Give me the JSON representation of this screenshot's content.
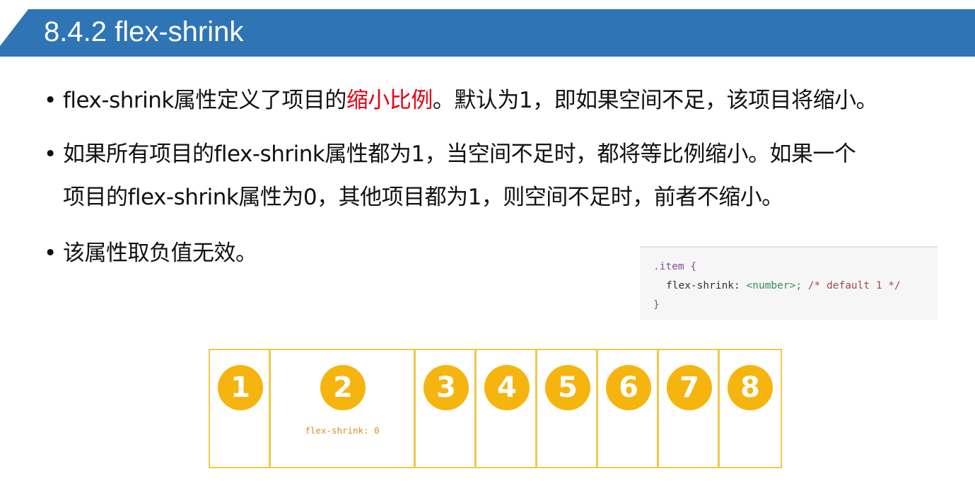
{
  "header": {
    "title": "8.4.2 flex-shrink"
  },
  "bullets": [
    {
      "lines": [
        {
          "before": "flex-shrink属性定义了项目的",
          "highlight": "缩小比例",
          "after": "。默认为1，即如果空间不足，该项目将缩小。"
        }
      ]
    },
    {
      "lines": [
        {
          "text": "如果所有项目的flex-shrink属性都为1，当空间不足时，都将等比例缩小。如果一个"
        },
        {
          "text": "项目的flex-shrink属性为0，其他项目都为1，则空间不足时，前者不缩小。"
        }
      ]
    },
    {
      "lines": [
        {
          "text": "该属性取负值无效。"
        }
      ]
    }
  ],
  "bullet_char": "•",
  "code": {
    "line1": ".item {",
    "line2_prop": "flex-shrink:",
    "line2_value": "<number>;",
    "line2_comment": "/* default 1 */",
    "line3": "}"
  },
  "flex_demo": {
    "items": [
      {
        "label": "1",
        "note": ""
      },
      {
        "label": "2",
        "note": "flex-shrink: 0"
      },
      {
        "label": "3",
        "note": ""
      },
      {
        "label": "4",
        "note": ""
      },
      {
        "label": "5",
        "note": ""
      },
      {
        "label": "6",
        "note": ""
      },
      {
        "label": "7",
        "note": ""
      },
      {
        "label": "8",
        "note": ""
      }
    ]
  },
  "colors": {
    "header_bg": "#2f75b5",
    "highlight": "#e60012",
    "item_border": "#f2c84b",
    "circle": "#f6b40e",
    "note": "#e38a1f"
  }
}
